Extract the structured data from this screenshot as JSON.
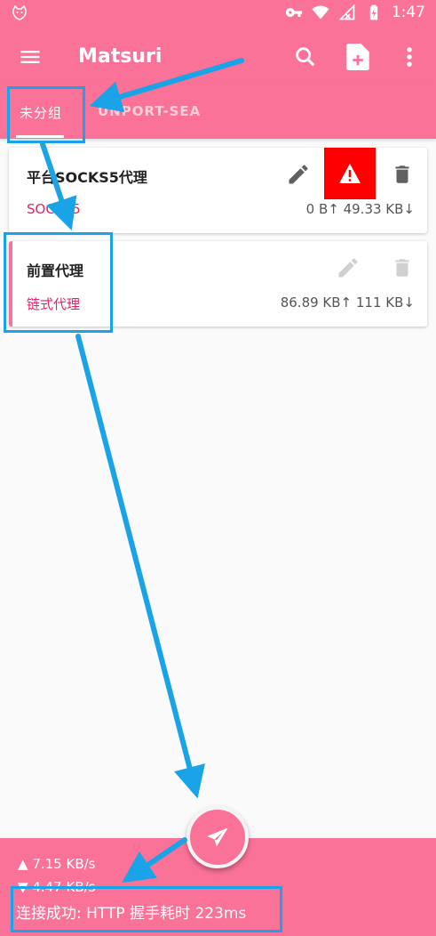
{
  "status_bar": {
    "time": "1:47"
  },
  "app_bar": {
    "title": "Matsuri"
  },
  "tabs": [
    {
      "label": "未分组",
      "selected": true
    },
    {
      "label": "UNPORT-SEA",
      "selected": false
    }
  ],
  "profiles": [
    {
      "name": "平台SOCKS5代理",
      "type": "SOCKS5",
      "traffic": "0 B↑ 49.33 KB↓",
      "warning": true
    },
    {
      "name": "前置代理",
      "type": "链式代理",
      "traffic": "86.89 KB↑ 111 KB↓",
      "selected": true
    }
  ],
  "stats": {
    "upload": "7.15 KB/s",
    "download": "4.47 KB/s",
    "connection": "连接成功: HTTP 握手耗时 223ms"
  },
  "colors": {
    "primary": "#fb7299",
    "accent": "#e91e63",
    "annotation": "#1aa3e6",
    "warning": "#ff0000"
  }
}
